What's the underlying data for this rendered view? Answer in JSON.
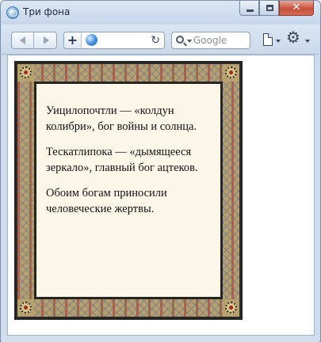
{
  "window": {
    "title": "Три фона",
    "close_glyph": "✕"
  },
  "toolbar": {
    "add_tab_label": "+",
    "reload_glyph": "↻",
    "search_placeholder": "Google",
    "gear_glyph": "⚙"
  },
  "icons": {
    "app": "browser-globe-icon",
    "back": "back-arrow-icon",
    "forward": "forward-arrow-icon",
    "site": "globe-icon",
    "reload": "reload-icon",
    "search": "search-icon",
    "page_menu": "page-icon",
    "settings": "gear-icon"
  },
  "colors": {
    "frame_base": "#b7a26f",
    "frame_accent": "#a5281e",
    "content_bg": "#fdf7ea"
  },
  "content": {
    "paragraphs": [
      "Уицилопочтли — «колдун колибри», бог войны и солнца.",
      "Тескатлипока — «дымящееся зеркало», главный бог ацтеков.",
      "Обоим богам приносили человеческие жертвы."
    ]
  }
}
